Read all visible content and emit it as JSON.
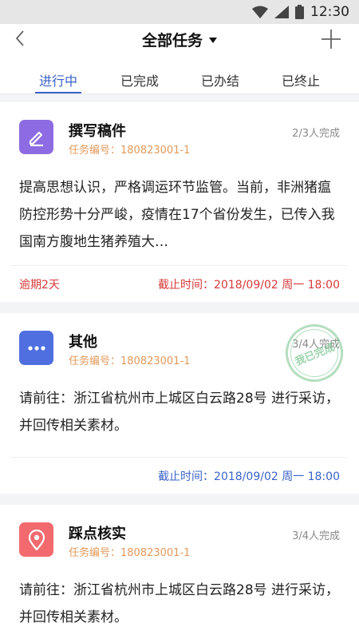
{
  "status_bar": {
    "time": "12:30"
  },
  "header": {
    "title": "全部任务",
    "tabs": [
      {
        "label": "进行中",
        "active": true
      },
      {
        "label": "已完成",
        "active": false
      },
      {
        "label": "已办结",
        "active": false
      },
      {
        "label": "已终止",
        "active": false
      }
    ]
  },
  "cards": [
    {
      "title": "撰写稿件",
      "code": "任务编号：180823001-1",
      "count": "2/3人完成",
      "body": "提高思想认识，严格调运环节监管。当前，非洲猪瘟防控形势十分严峻，疫情在17个省份发生，已传入我国南方腹地生猪养殖大…",
      "overdue": "逾期2天",
      "deadline": "截止时间：2018/09/02 周一 18:00",
      "icon_color": "#8d6be2"
    },
    {
      "title": "其他",
      "code": "任务编号：180823001-1",
      "count": "3/4人完成",
      "body": "请前往：浙江省杭州市上城区白云路28号 进行采访，并回传相关素材。",
      "deadline": "截止时间：2018/09/02 周一 18:00",
      "stamp": "我已完成",
      "icon_color": "#4f6fe0"
    },
    {
      "title": "踩点核实",
      "code": "任务编号：180823001-1",
      "count": "3/4人完成",
      "body": "请前往：浙江省杭州市上城区白云路28号 进行采访，并回传相关素材。",
      "icon_color": "#f26a6e"
    }
  ]
}
